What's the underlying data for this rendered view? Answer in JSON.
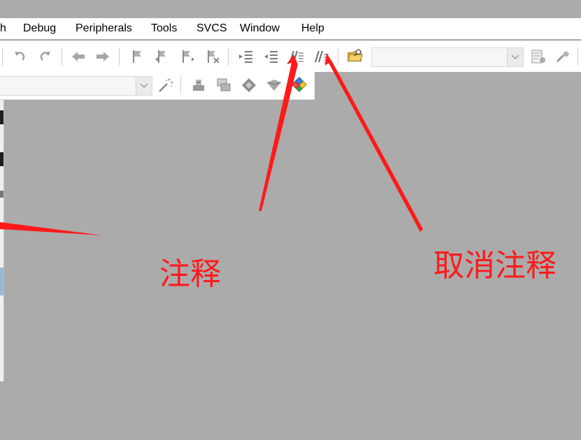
{
  "menubar": {
    "items": [
      "h",
      "Debug",
      "Peripherals",
      "Tools",
      "SVCS",
      "Window",
      "Help"
    ]
  },
  "toolbar1": {
    "buttons": [
      "undo-icon",
      "redo-icon",
      "nav-back-icon",
      "nav-forward-icon",
      "bookmark-toggle-icon",
      "bookmark-prev-icon",
      "bookmark-next-icon",
      "bookmark-clear-icon",
      "indent-icon",
      "unindent-icon",
      "comment-icon",
      "uncomment-icon",
      "find-in-files-icon",
      "configure-icon",
      "debug-settings-icon"
    ],
    "search_combo_value": ""
  },
  "toolbar2": {
    "target_combo_value": "",
    "buttons": [
      "magic-wand-icon",
      "load-icon",
      "translate-icon",
      "diamond-icon",
      "pack-installer-icon",
      "rte-manage-icon"
    ]
  },
  "annotations": {
    "comment_label": "注释",
    "uncomment_label": "取消注释",
    "color": "#ff1a1a"
  }
}
